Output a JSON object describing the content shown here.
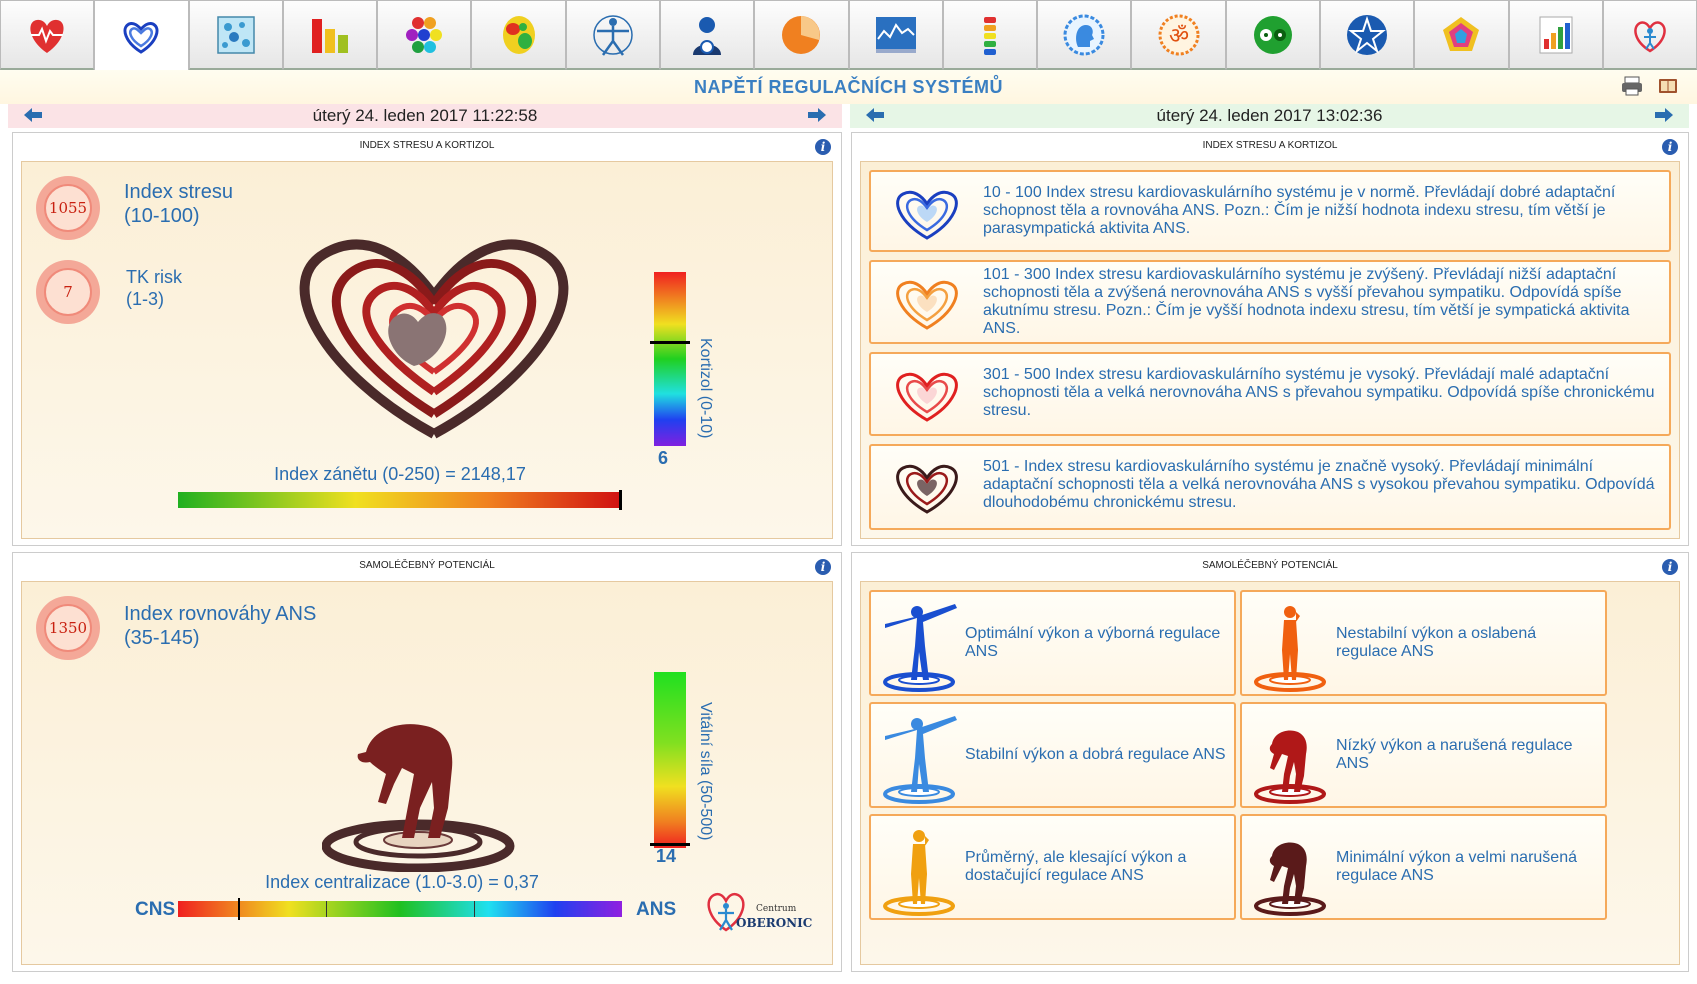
{
  "toolbar": {
    "tabs": [
      "heart-ecg-icon",
      "heart-waves-icon",
      "cells-grid-icon",
      "bar-chart-icon",
      "hexagons-icon",
      "brain-map-icon",
      "vitruvian-man-icon",
      "person-profile-icon",
      "pie-chart-icon",
      "monitor-graph-icon",
      "spine-icon",
      "head-profile-icon",
      "om-icon",
      "yin-yang-icon",
      "pentagram-icon",
      "pentagon-chart-icon",
      "small-bar-chart-icon",
      "oberonic-logo-icon"
    ],
    "active_index": 1
  },
  "page_title": "NAPĚTÍ REGULAČNÍCH SYSTÉMŮ",
  "left_date": "úterý 24. leden 2017 11:22:58",
  "right_date": "úterý 24. leden 2017 13:02:36",
  "colors": {
    "accent": "#2a6db0",
    "header_left_bg": "#fbe3e6",
    "header_right_bg": "#e6f6e6",
    "card_border": "#f5a95a"
  },
  "stress": {
    "header": "INDEX STRESU A KORTIZOL",
    "index_value": "1055",
    "index_label": "Index stresu",
    "index_range": "(10-100)",
    "tk_value": "7",
    "tk_label": "TK risk",
    "tk_range": "(1-3)",
    "kortizol_label": "Kortizol (0-10)",
    "kortizol_value": "6",
    "kortizol_fraction": 0.6,
    "inflammation_label": "Index zánětu (0-250) = 2148,17",
    "inflammation_fraction": 1.0
  },
  "stress_legend": {
    "header": "INDEX STRESU A KORTIZOL",
    "items": [
      {
        "icon": "heart-blue-icon",
        "text": "10 - 100 Index stresu kardiovaskulárního systému je v normě. Převládají dobré adaptační schopnost těla a rovnováha ANS. Pozn.: Čím je nižší hodnota indexu stresu, tím větší je parasympatická aktivita ANS."
      },
      {
        "icon": "heart-orange-icon",
        "text": "101 - 300 Index stresu kardiovaskulárního systému je zvýšený. Převládají nižší adaptační schopnosti těla a zvýšená nerovnováha ANS s vyšší převahou sympatiku. Odpovídá spíše akutnímu stresu. Pozn.: Čím je vyšší hodnota indexu stresu, tím větší je sympatická aktivita ANS."
      },
      {
        "icon": "heart-red-icon",
        "text": "301 - 500 Index stresu kardiovaskulárního systému je vysoký. Převládají malé adaptační schopnosti těla a velká nerovnováha ANS s převahou sympatiku. Odpovídá spíše chronickému stresu."
      },
      {
        "icon": "heart-dark-icon",
        "text": "501 - Index stresu kardiovaskulárního systému je značně vysoký. Převládají minimální adaptační schopnosti těla a velká nerovnováha ANS s vysokou převahou sympatiku. Odpovídá dlouhodobému chronickému stresu."
      }
    ]
  },
  "healing": {
    "header": "SAMOLÉČEBNÝ POTENCIÁL",
    "ans_value": "1350",
    "ans_label": "Index rovnováhy ANS",
    "ans_range": "(35-145)",
    "vital_label": "Vitální síla (50-500)",
    "vital_value": "14",
    "vital_fraction": 0.02,
    "central_label": "Index centralizace (1.0-3.0) = 0,37",
    "cns_label": "CNS",
    "ans_end_label": "ANS",
    "logo_small": "Centrum",
    "logo_big": "OBERONIC"
  },
  "healing_legend": {
    "header": "SAMOLÉČEBNÝ POTENCIÁL",
    "items": [
      {
        "icon": "person-blue-open-icon",
        "text": "Optimální výkon a výborná regulace ANS",
        "color": "#1a4fd0"
      },
      {
        "icon": "person-orange-thinking-icon",
        "text": "Nestabilní výkon a oslabená regulace ANS",
        "color": "#f06010"
      },
      {
        "icon": "person-lightblue-open-icon",
        "text": "Stabilní výkon a dobrá regulace ANS",
        "color": "#3a8ae0"
      },
      {
        "icon": "person-red-bent-icon",
        "text": "Nízký výkon a narušená regulace ANS",
        "color": "#b01818"
      },
      {
        "icon": "person-yellow-thinking-icon",
        "text": "Průměrný, ale klesající výkon a dostačující regulace ANS",
        "color": "#f0a010"
      },
      {
        "icon": "person-dark-bent-icon",
        "text": "Minimální výkon a velmi narušená regulace ANS",
        "color": "#5a1a1a"
      }
    ]
  }
}
